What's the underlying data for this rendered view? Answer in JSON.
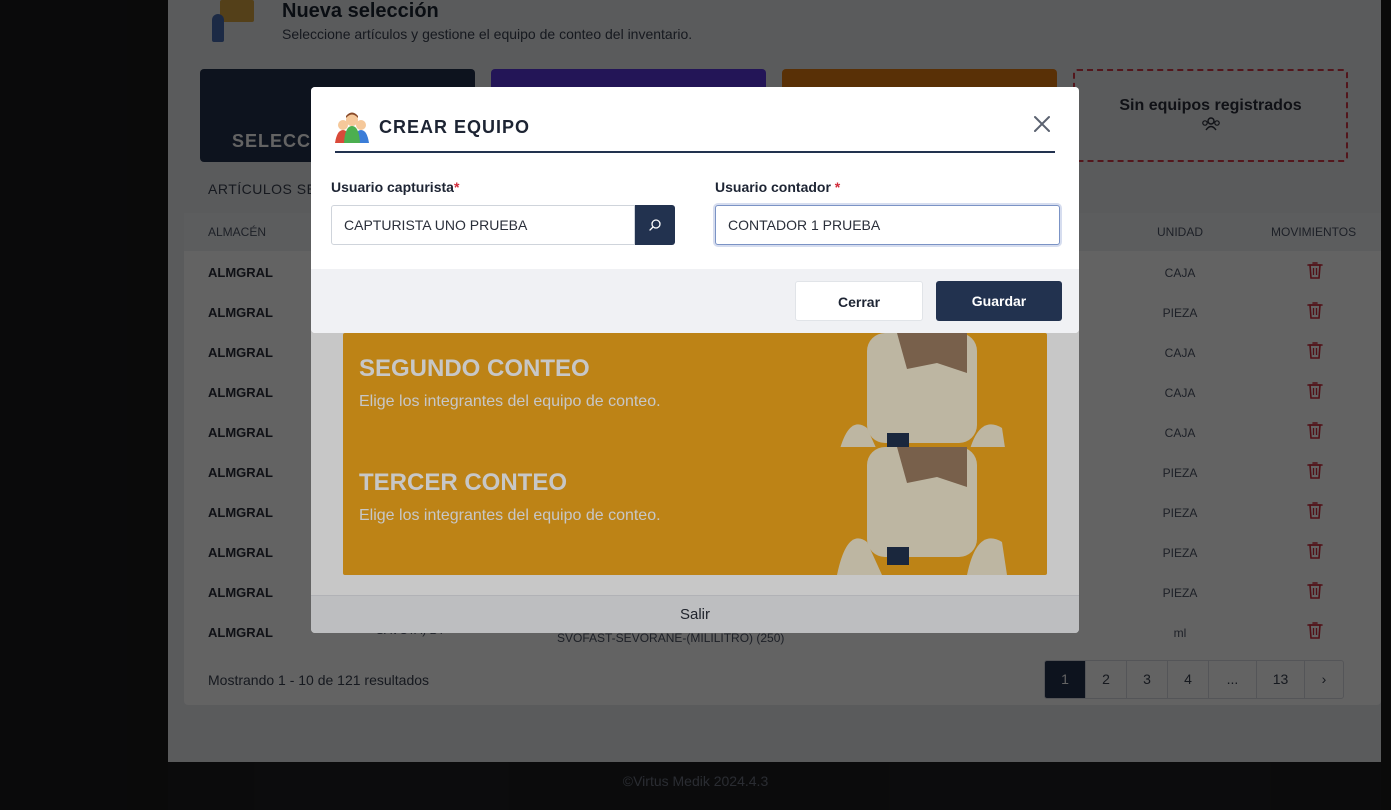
{
  "header": {
    "title": "Nueva selección",
    "subtitle": "Seleccione artículos y gestione el equipo de conteo del inventario."
  },
  "cards": {
    "dark_label": "SELECCI",
    "empty_title": "Sin equipos registrados",
    "empty_icon": "team-icon"
  },
  "section_label": "ARTÍCULOS SE",
  "table": {
    "headers": {
      "almacen": "ALMACÉN",
      "unidad": "UNIDAD",
      "movimientos": "MOVIMIENTOS"
    },
    "rows": [
      {
        "almacen": "ALMGRAL",
        "unidad": "CAJA"
      },
      {
        "almacen": "ALMGRAL",
        "unidad": "PIEZA"
      },
      {
        "almacen": "ALMGRAL",
        "unidad": "CAJA"
      },
      {
        "almacen": "ALMGRAL",
        "unidad": "CAJA"
      },
      {
        "almacen": "ALMGRAL",
        "unidad": "CAJA"
      },
      {
        "almacen": "ALMGRAL",
        "unidad": "PIEZA"
      },
      {
        "almacen": "ALMGRAL",
        "unidad": "PIEZA"
      },
      {
        "almacen": "ALMGRAL",
        "unidad": "PIEZA"
      },
      {
        "almacen": "ALMGRAL",
        "unidad": "PIEZA"
      },
      {
        "almacen": "ALMGRAL",
        "codigo": "SAVCTA) BT",
        "descripcion": "SVOFAST-SEVORANE-(MILILITRO) (250)",
        "unidad": "ml"
      }
    ],
    "footer_count": "Mostrando 1 - 10 de 121 resultados",
    "pagination": [
      "1",
      "2",
      "3",
      "4",
      "...",
      "13"
    ],
    "pagination_next": "›"
  },
  "app_footer": "©Virtus Medik 2024.4.3",
  "team_modal": {
    "banners": [
      {
        "title": "SEGUNDO CONTEO",
        "subtitle": "Elige los integrantes del equipo de conteo."
      },
      {
        "title": "TERCER CONTEO",
        "subtitle": "Elige los integrantes del equipo de conteo."
      }
    ],
    "footer_button": "Salir"
  },
  "create_modal": {
    "title": "CREAR EQUIPO",
    "capturista_label": "Usuario capturista",
    "capturista_value": "CAPTURISTA UNO PRUEBA",
    "contador_label": "Usuario contador ",
    "contador_value": "CONTADOR 1 PRUEBA",
    "required_mark": "*",
    "close_button": "Cerrar",
    "save_button": "Guardar"
  },
  "colors": {
    "primary": "#22324f",
    "required": "#d12b3a",
    "banner": "#f2a81d",
    "trash": "#d12b3a"
  }
}
